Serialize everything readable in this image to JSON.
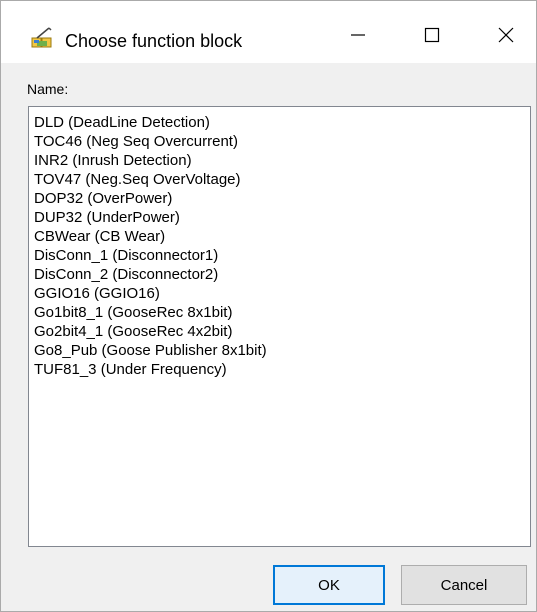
{
  "window": {
    "title": "Choose function block",
    "app_icon": "function-block-app-icon",
    "caption_buttons": {
      "minimize_icon": "minimize-icon",
      "maximize_icon": "maximize-icon",
      "close_icon": "close-icon"
    }
  },
  "form": {
    "name_label": "Name:"
  },
  "list": {
    "items": [
      "DLD (DeadLine Detection)",
      "TOC46 (Neg Seq Overcurrent)",
      "INR2 (Inrush Detection)",
      "TOV47 (Neg.Seq OverVoltage)",
      "DOP32 (OverPower)",
      "DUP32 (UnderPower)",
      "CBWear (CB Wear)",
      "DisConn_1 (Disconnector1)",
      "DisConn_2 (Disconnector2)",
      "GGIO16 (GGIO16)",
      "Go1bit8_1 (GooseRec 8x1bit)",
      "Go2bit4_1 (GooseRec 4x2bit)",
      "Go8_Pub (Goose Publisher 8x1bit)",
      "TUF81_3 (Under Frequency)"
    ]
  },
  "buttons": {
    "ok_label": "OK",
    "cancel_label": "Cancel"
  },
  "colors": {
    "window_bg": "#f0f0f0",
    "titlebar_bg": "#ffffff",
    "focus_border": "#0078d7",
    "ok_bg": "#e5f1fb",
    "button_bg": "#e1e1e1"
  }
}
